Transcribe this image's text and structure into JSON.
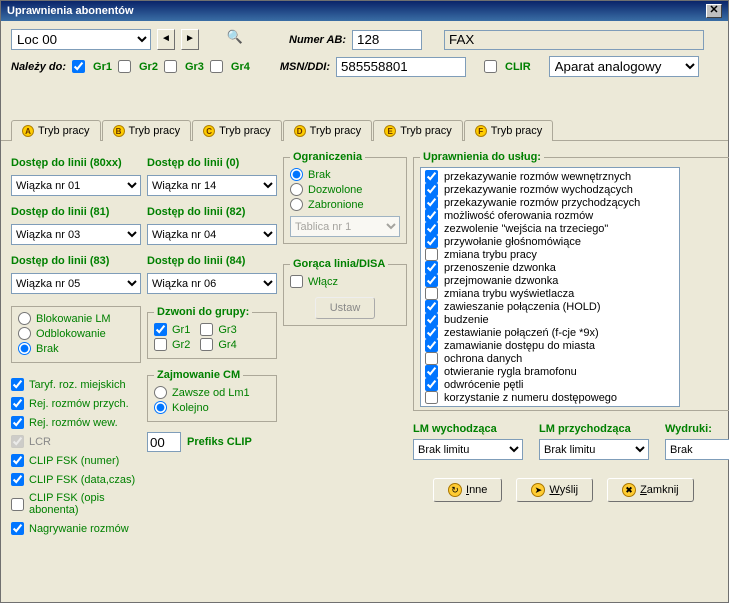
{
  "titlebar": {
    "title": "Uprawnienia abonentów"
  },
  "top": {
    "loc_select": "Loc 00",
    "numer_ab_label": "Numer AB:",
    "numer_ab_value": "128",
    "device_name": "FAX",
    "nalezy_do_label": "Należy do:",
    "gr1": "Gr1",
    "gr2": "Gr2",
    "gr3": "Gr3",
    "gr4": "Gr4",
    "msn_label": "MSN/DDI:",
    "msn_value": "585558801",
    "clir_label": "CLIR",
    "device_type": "Aparat analogowy"
  },
  "tabs": {
    "a": "Tryb pracy",
    "b": "Tryb pracy",
    "c": "Tryb pracy",
    "d": "Tryb pracy",
    "e": "Tryb pracy",
    "f": "Tryb pracy",
    "letters": {
      "a": "A",
      "b": "B",
      "c": "C",
      "d": "D",
      "e": "E",
      "f": "F"
    }
  },
  "access": {
    "l80xx": {
      "label": "Dostęp do linii (80xx)",
      "val": "Wiązka nr  01"
    },
    "l0": {
      "label": "Dostęp do linii (0)",
      "val": "Wiązka nr  14"
    },
    "l81": {
      "label": "Dostęp do linii (81)",
      "val": "Wiązka nr  03"
    },
    "l82": {
      "label": "Dostęp do linii (82)",
      "val": "Wiązka nr  04"
    },
    "l83": {
      "label": "Dostęp do linii (83)",
      "val": "Wiązka nr  05"
    },
    "l84": {
      "label": "Dostęp do linii (84)",
      "val": "Wiązka nr  06"
    }
  },
  "blok": {
    "r1": "Blokowanie LM",
    "r2": "Odblokowanie",
    "r3": "Brak"
  },
  "dzwoni": {
    "legend": "Dzwoni do grupy:",
    "g1": "Gr1",
    "g2": "Gr2",
    "g3": "Gr3",
    "g4": "Gr4"
  },
  "zajm": {
    "legend": "Zajmowanie CM",
    "r1": "Zawsze od Lm1",
    "r2": "Kolejno"
  },
  "chk_left": {
    "c1": "Taryf. roz. miejskich",
    "c2": "Rej. rozmów przych.",
    "c3": "Rej. rozmów wew.",
    "c4": "LCR",
    "c5": "CLIP FSK (numer)",
    "c6": "CLIP FSK (data,czas)",
    "c7": "CLIP FSK (opis abonenta)",
    "c8": "Nagrywanie rozmów"
  },
  "prefiks": {
    "val": "00",
    "label": "Prefiks CLIP"
  },
  "ogr": {
    "legend": "Ograniczenia",
    "r1": "Brak",
    "r2": "Dozwolone",
    "r3": "Zabronione",
    "tab": "Tablica nr  1"
  },
  "goraca": {
    "legend": "Gorąca linia/DISA",
    "chk": "Włącz",
    "btn": "Ustaw"
  },
  "perm": {
    "legend": "Uprawnienia do usług:",
    "items": [
      {
        "c": true,
        "t": "przekazywanie rozmów wewnętrznych"
      },
      {
        "c": true,
        "t": "przekazywanie rozmów wychodzących"
      },
      {
        "c": true,
        "t": "przekazywanie rozmów przychodzących"
      },
      {
        "c": true,
        "t": "możliwość oferowania rozmów"
      },
      {
        "c": true,
        "t": "zezwolenie \"wejścia na trzeciego\""
      },
      {
        "c": true,
        "t": "przywołanie głośnomówiące"
      },
      {
        "c": false,
        "t": "zmiana trybu pracy"
      },
      {
        "c": true,
        "t": "przenoszenie dzwonka"
      },
      {
        "c": true,
        "t": "przejmowanie dzwonka"
      },
      {
        "c": false,
        "t": "zmiana trybu wyświetlacza"
      },
      {
        "c": true,
        "t": "zawieszanie połączenia (HOLD)"
      },
      {
        "c": true,
        "t": "budzenie"
      },
      {
        "c": true,
        "t": "zestawianie połączeń (f-cje *9x)"
      },
      {
        "c": true,
        "t": "zamawianie dostępu do miasta"
      },
      {
        "c": false,
        "t": "ochrona danych"
      },
      {
        "c": true,
        "t": "otwieranie rygla bramofonu"
      },
      {
        "c": true,
        "t": "odwrócenie pętli"
      },
      {
        "c": false,
        "t": "korzystanie z numeru dostępowego"
      }
    ]
  },
  "bottom": {
    "lm_out": "LM wychodząca",
    "lm_in": "LM przychodząca",
    "wydruki": "Wydruki:",
    "brak_lim": "Brak limitu",
    "brak": "Brak",
    "inne": "Inne",
    "wyslij": "Wyślij",
    "zamknij": "Zamknij"
  }
}
